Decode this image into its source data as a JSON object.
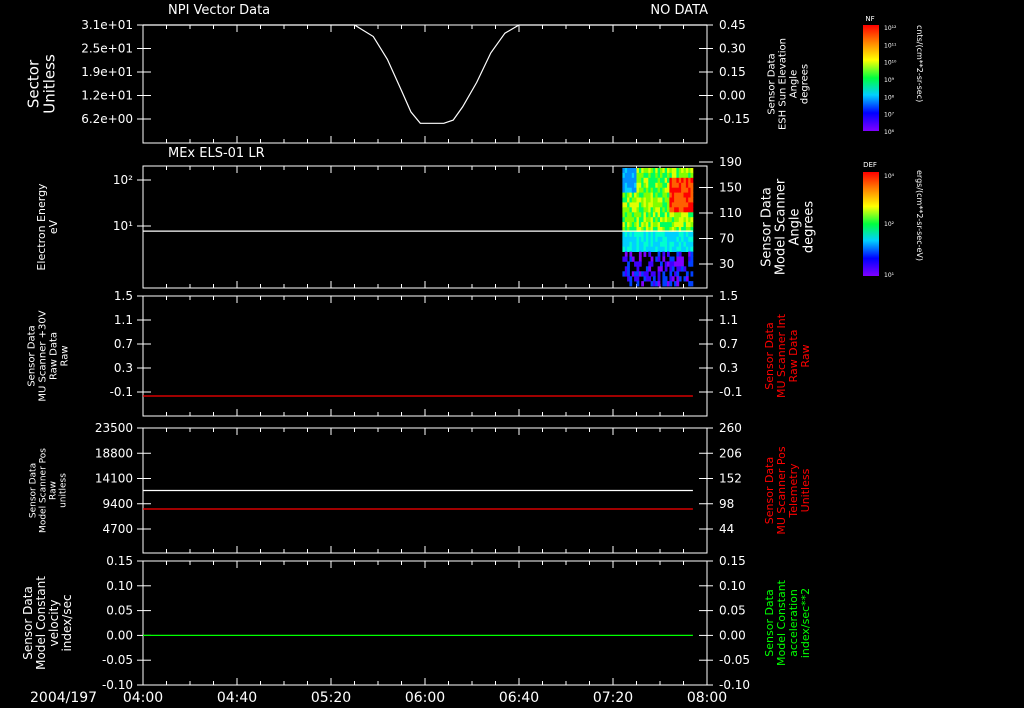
{
  "title_left": "NPI Vector Data",
  "title_right": "NO DATA",
  "date_label": "2004/197",
  "time_ticks": [
    "04:00",
    "04:40",
    "05:20",
    "06:00",
    "06:40",
    "07:20",
    "08:00"
  ],
  "colors": {
    "background": "#000000",
    "axis": "#ffffff",
    "red_series": "#ff0000",
    "green_series": "#00ff00"
  },
  "chart_data": [
    {
      "type": "line",
      "title": "NPI Vector Data",
      "ylabel_left": [
        "Sector",
        "Unitless"
      ],
      "ylabel_right": [
        "Sensor Data",
        "ESH Sun Elevation",
        "Angle",
        "degrees"
      ],
      "left_ticks": [
        "3.1e+01",
        "2.5e+01",
        "1.9e+01",
        "1.2e+01",
        "6.2e+00"
      ],
      "right_ticks": [
        "0.45",
        "0.30",
        "0.15",
        "0.00",
        "-0.15"
      ],
      "ylim_right": [
        -0.27,
        0.45
      ],
      "series": [
        {
          "axis": "right",
          "color": "#ffffff",
          "x": [
            "05:30",
            "05:38",
            "05:44",
            "05:50",
            "05:54",
            "05:58",
            "06:08",
            "06:12",
            "06:16",
            "06:22",
            "06:28",
            "06:34",
            "06:40"
          ],
          "values": [
            0.45,
            0.38,
            0.24,
            0.05,
            -0.08,
            -0.15,
            -0.15,
            -0.13,
            -0.05,
            0.1,
            0.28,
            0.4,
            0.45
          ]
        }
      ]
    },
    {
      "type": "heatmap",
      "title": "MEx ELS-01 LR",
      "ylabel_left": [
        "Electron Energy",
        "eV"
      ],
      "ylabel_right": [
        "Sensor Data",
        "Model Scanner",
        "Angle",
        "degrees"
      ],
      "left_ticks": [
        "10²",
        "10¹"
      ],
      "right_ticks": [
        "190",
        "150",
        "110",
        "70",
        "30"
      ],
      "scale": "log",
      "data_window": [
        "07:24",
        "07:54"
      ],
      "series": [
        {
          "axis": "right",
          "color": "#ffffff",
          "x": [
            "04:00",
            "07:54"
          ],
          "values": [
            94,
            94
          ]
        }
      ],
      "colorbar": {
        "label": "DEF",
        "units": "ergs/(cm**2-sr-sec-eV)",
        "ticks": [
          "10⁴",
          "10²",
          "10¹"
        ]
      }
    },
    {
      "type": "line",
      "ylabel_left": [
        "Sensor Data",
        "MU Scanner +30V",
        "Raw Data",
        "Raw"
      ],
      "ylabel_right": [
        "Sensor Data",
        "MU Scanner Int",
        "Raw Data",
        "Raw"
      ],
      "left_ticks": [
        "1.5",
        "1.1",
        "0.7",
        "0.3",
        "-0.1"
      ],
      "right_ticks": [
        "1.5",
        "1.1",
        "0.7",
        "0.3",
        "-0.1"
      ],
      "ylim": [
        -0.3,
        1.5
      ],
      "series": [
        {
          "axis": "right",
          "color": "#ff0000",
          "x": [
            "04:00",
            "07:54"
          ],
          "values": [
            0.0,
            0.0
          ]
        }
      ]
    },
    {
      "type": "line",
      "ylabel_left": [
        "Sensor Data",
        "Model Scanner Pos",
        "Raw",
        "unitless"
      ],
      "ylabel_right": [
        "Sensor Data",
        "MU Scanner Pos",
        "Telemetry",
        "Unitless"
      ],
      "left_ticks": [
        "23500",
        "18800",
        "14100",
        "9400",
        "4700"
      ],
      "right_ticks": [
        "260",
        "206",
        "152",
        "98",
        "44"
      ],
      "ylim_left": [
        0,
        23500
      ],
      "ylim_right": [
        -10,
        260
      ],
      "series": [
        {
          "axis": "left",
          "color": "#ffffff",
          "x": [
            "04:00",
            "07:54"
          ],
          "values": [
            11750,
            11750
          ]
        },
        {
          "axis": "right",
          "color": "#ff0000",
          "x": [
            "04:00",
            "07:54"
          ],
          "values": [
            85,
            85
          ]
        }
      ]
    },
    {
      "type": "line",
      "ylabel_left": [
        "Sensor Data",
        "Model Constant",
        "velocity",
        "index/sec"
      ],
      "ylabel_right": [
        "Sensor Data",
        "Model Constant",
        "acceleration",
        "index/sec**2"
      ],
      "left_ticks": [
        "0.15",
        "0.10",
        "0.05",
        "0.00",
        "-0.05",
        "-0.10"
      ],
      "right_ticks": [
        "0.15",
        "0.10",
        "0.05",
        "0.00",
        "-0.05",
        "-0.10"
      ],
      "ylim": [
        -0.1,
        0.15
      ],
      "series": [
        {
          "axis": "right",
          "color": "#00ff00",
          "x": [
            "04:00",
            "07:54"
          ],
          "values": [
            0.0,
            0.0
          ]
        }
      ]
    }
  ],
  "colorbar_nf": {
    "label": "NF",
    "units": "cnts/(cm**2-sr-sec)",
    "ticks": [
      "10¹²",
      "10¹¹",
      "10¹⁰",
      "10⁹",
      "10⁸",
      "10⁷",
      "10⁶"
    ]
  }
}
